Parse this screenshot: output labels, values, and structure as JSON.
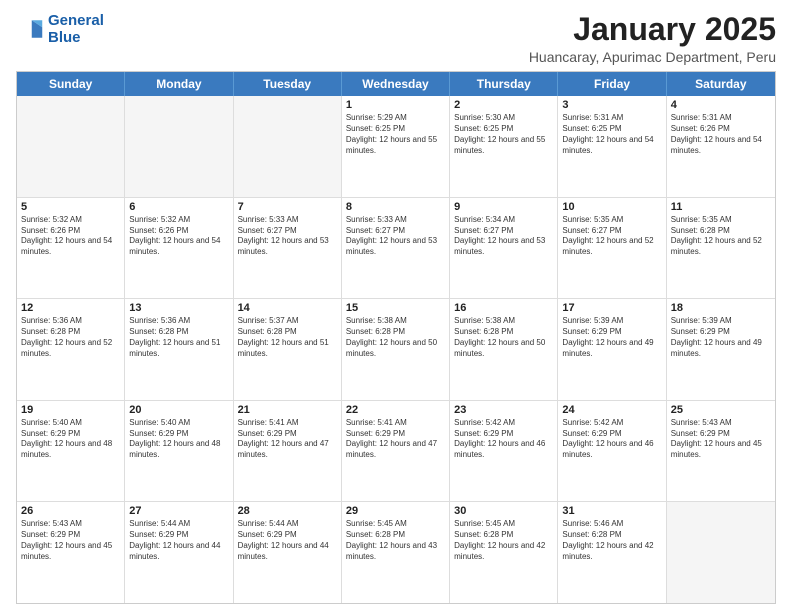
{
  "logo": {
    "line1": "General",
    "line2": "Blue"
  },
  "title": "January 2025",
  "subtitle": "Huancaray, Apurimac Department, Peru",
  "headers": [
    "Sunday",
    "Monday",
    "Tuesday",
    "Wednesday",
    "Thursday",
    "Friday",
    "Saturday"
  ],
  "weeks": [
    [
      {
        "day": "",
        "sunrise": "",
        "sunset": "",
        "daylight": ""
      },
      {
        "day": "",
        "sunrise": "",
        "sunset": "",
        "daylight": ""
      },
      {
        "day": "",
        "sunrise": "",
        "sunset": "",
        "daylight": ""
      },
      {
        "day": "1",
        "sunrise": "Sunrise: 5:29 AM",
        "sunset": "Sunset: 6:25 PM",
        "daylight": "Daylight: 12 hours and 55 minutes."
      },
      {
        "day": "2",
        "sunrise": "Sunrise: 5:30 AM",
        "sunset": "Sunset: 6:25 PM",
        "daylight": "Daylight: 12 hours and 55 minutes."
      },
      {
        "day": "3",
        "sunrise": "Sunrise: 5:31 AM",
        "sunset": "Sunset: 6:25 PM",
        "daylight": "Daylight: 12 hours and 54 minutes."
      },
      {
        "day": "4",
        "sunrise": "Sunrise: 5:31 AM",
        "sunset": "Sunset: 6:26 PM",
        "daylight": "Daylight: 12 hours and 54 minutes."
      }
    ],
    [
      {
        "day": "5",
        "sunrise": "Sunrise: 5:32 AM",
        "sunset": "Sunset: 6:26 PM",
        "daylight": "Daylight: 12 hours and 54 minutes."
      },
      {
        "day": "6",
        "sunrise": "Sunrise: 5:32 AM",
        "sunset": "Sunset: 6:26 PM",
        "daylight": "Daylight: 12 hours and 54 minutes."
      },
      {
        "day": "7",
        "sunrise": "Sunrise: 5:33 AM",
        "sunset": "Sunset: 6:27 PM",
        "daylight": "Daylight: 12 hours and 53 minutes."
      },
      {
        "day": "8",
        "sunrise": "Sunrise: 5:33 AM",
        "sunset": "Sunset: 6:27 PM",
        "daylight": "Daylight: 12 hours and 53 minutes."
      },
      {
        "day": "9",
        "sunrise": "Sunrise: 5:34 AM",
        "sunset": "Sunset: 6:27 PM",
        "daylight": "Daylight: 12 hours and 53 minutes."
      },
      {
        "day": "10",
        "sunrise": "Sunrise: 5:35 AM",
        "sunset": "Sunset: 6:27 PM",
        "daylight": "Daylight: 12 hours and 52 minutes."
      },
      {
        "day": "11",
        "sunrise": "Sunrise: 5:35 AM",
        "sunset": "Sunset: 6:28 PM",
        "daylight": "Daylight: 12 hours and 52 minutes."
      }
    ],
    [
      {
        "day": "12",
        "sunrise": "Sunrise: 5:36 AM",
        "sunset": "Sunset: 6:28 PM",
        "daylight": "Daylight: 12 hours and 52 minutes."
      },
      {
        "day": "13",
        "sunrise": "Sunrise: 5:36 AM",
        "sunset": "Sunset: 6:28 PM",
        "daylight": "Daylight: 12 hours and 51 minutes."
      },
      {
        "day": "14",
        "sunrise": "Sunrise: 5:37 AM",
        "sunset": "Sunset: 6:28 PM",
        "daylight": "Daylight: 12 hours and 51 minutes."
      },
      {
        "day": "15",
        "sunrise": "Sunrise: 5:38 AM",
        "sunset": "Sunset: 6:28 PM",
        "daylight": "Daylight: 12 hours and 50 minutes."
      },
      {
        "day": "16",
        "sunrise": "Sunrise: 5:38 AM",
        "sunset": "Sunset: 6:28 PM",
        "daylight": "Daylight: 12 hours and 50 minutes."
      },
      {
        "day": "17",
        "sunrise": "Sunrise: 5:39 AM",
        "sunset": "Sunset: 6:29 PM",
        "daylight": "Daylight: 12 hours and 49 minutes."
      },
      {
        "day": "18",
        "sunrise": "Sunrise: 5:39 AM",
        "sunset": "Sunset: 6:29 PM",
        "daylight": "Daylight: 12 hours and 49 minutes."
      }
    ],
    [
      {
        "day": "19",
        "sunrise": "Sunrise: 5:40 AM",
        "sunset": "Sunset: 6:29 PM",
        "daylight": "Daylight: 12 hours and 48 minutes."
      },
      {
        "day": "20",
        "sunrise": "Sunrise: 5:40 AM",
        "sunset": "Sunset: 6:29 PM",
        "daylight": "Daylight: 12 hours and 48 minutes."
      },
      {
        "day": "21",
        "sunrise": "Sunrise: 5:41 AM",
        "sunset": "Sunset: 6:29 PM",
        "daylight": "Daylight: 12 hours and 47 minutes."
      },
      {
        "day": "22",
        "sunrise": "Sunrise: 5:41 AM",
        "sunset": "Sunset: 6:29 PM",
        "daylight": "Daylight: 12 hours and 47 minutes."
      },
      {
        "day": "23",
        "sunrise": "Sunrise: 5:42 AM",
        "sunset": "Sunset: 6:29 PM",
        "daylight": "Daylight: 12 hours and 46 minutes."
      },
      {
        "day": "24",
        "sunrise": "Sunrise: 5:42 AM",
        "sunset": "Sunset: 6:29 PM",
        "daylight": "Daylight: 12 hours and 46 minutes."
      },
      {
        "day": "25",
        "sunrise": "Sunrise: 5:43 AM",
        "sunset": "Sunset: 6:29 PM",
        "daylight": "Daylight: 12 hours and 45 minutes."
      }
    ],
    [
      {
        "day": "26",
        "sunrise": "Sunrise: 5:43 AM",
        "sunset": "Sunset: 6:29 PM",
        "daylight": "Daylight: 12 hours and 45 minutes."
      },
      {
        "day": "27",
        "sunrise": "Sunrise: 5:44 AM",
        "sunset": "Sunset: 6:29 PM",
        "daylight": "Daylight: 12 hours and 44 minutes."
      },
      {
        "day": "28",
        "sunrise": "Sunrise: 5:44 AM",
        "sunset": "Sunset: 6:29 PM",
        "daylight": "Daylight: 12 hours and 44 minutes."
      },
      {
        "day": "29",
        "sunrise": "Sunrise: 5:45 AM",
        "sunset": "Sunset: 6:28 PM",
        "daylight": "Daylight: 12 hours and 43 minutes."
      },
      {
        "day": "30",
        "sunrise": "Sunrise: 5:45 AM",
        "sunset": "Sunset: 6:28 PM",
        "daylight": "Daylight: 12 hours and 42 minutes."
      },
      {
        "day": "31",
        "sunrise": "Sunrise: 5:46 AM",
        "sunset": "Sunset: 6:28 PM",
        "daylight": "Daylight: 12 hours and 42 minutes."
      },
      {
        "day": "",
        "sunrise": "",
        "sunset": "",
        "daylight": ""
      }
    ]
  ]
}
